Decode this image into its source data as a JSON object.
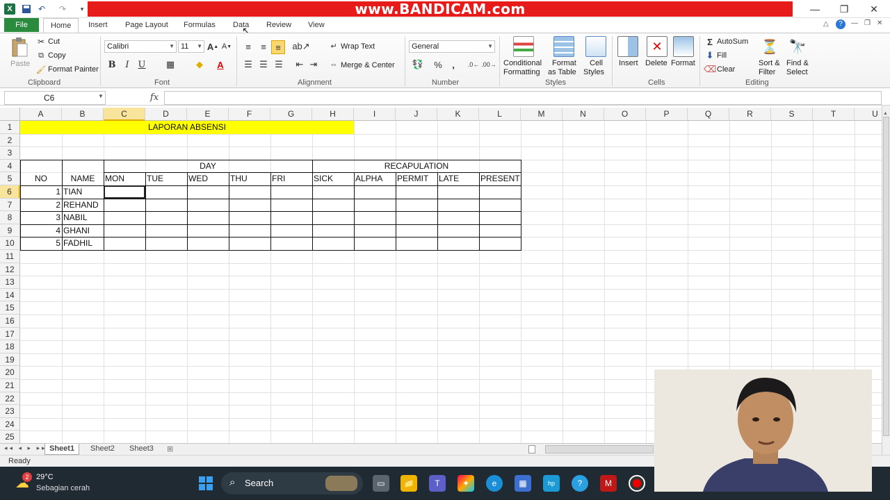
{
  "window": {
    "watermark": "www.BANDICAM.com",
    "minimize": "—",
    "restore": "❐",
    "close": "✕"
  },
  "tabs": {
    "file": "File",
    "items": [
      "Home",
      "Insert",
      "Page Layout",
      "Formulas",
      "Data",
      "Review",
      "View"
    ]
  },
  "ribbon": {
    "clipboard": {
      "paste": "Paste",
      "cut": "Cut",
      "copy": "Copy",
      "format_painter": "Format Painter",
      "label": "Clipboard"
    },
    "font": {
      "name": "Calibri",
      "size": "11",
      "bold": "B",
      "italic": "I",
      "underline": "U",
      "label": "Font"
    },
    "alignment": {
      "wrap_text": "Wrap Text",
      "merge_center": "Merge & Center",
      "label": "Alignment"
    },
    "number": {
      "format": "General",
      "percent": "%",
      "comma": ",",
      "label": "Number"
    },
    "styles": {
      "conditional": "Conditional",
      "conditional2": "Formatting",
      "format_as": "Format",
      "format_as2": "as Table",
      "cell": "Cell",
      "cell2": "Styles",
      "label": "Styles"
    },
    "cells": {
      "insert": "Insert",
      "delete": "Delete",
      "format": "Format",
      "label": "Cells"
    },
    "editing": {
      "autosum": "AutoSum",
      "fill": "Fill",
      "clear": "Clear",
      "sort": "Sort &",
      "sort2": "Filter",
      "find": "Find &",
      "find2": "Select",
      "label": "Editing"
    }
  },
  "formula_bar": {
    "name_box": "C6",
    "fx": "fx",
    "content": ""
  },
  "grid": {
    "columns": [
      "A",
      "B",
      "C",
      "D",
      "E",
      "F",
      "G",
      "H",
      "I",
      "J",
      "K",
      "L",
      "M",
      "N",
      "O",
      "P",
      "Q",
      "R",
      "S",
      "T",
      "U"
    ],
    "rows": [
      "1",
      "2",
      "3",
      "4",
      "5",
      "6",
      "7",
      "8",
      "9",
      "10",
      "11",
      "12",
      "13",
      "14",
      "15",
      "16",
      "17",
      "18",
      "19",
      "20",
      "21",
      "22",
      "23",
      "24",
      "25"
    ],
    "title": "LAPORAN ABSENSI",
    "day_header": "DAY",
    "recap_header": "RECAPULATION",
    "no_header": "NO",
    "name_header": "NAME",
    "sub_headers": [
      "MON",
      "TUE",
      "WED",
      "THU",
      "FRI",
      "SICK",
      "ALPHA",
      "PERMIT",
      "LATE",
      "PRESENT"
    ],
    "students": [
      {
        "no": "1",
        "name": "TIAN"
      },
      {
        "no": "2",
        "name": "REHAND"
      },
      {
        "no": "3",
        "name": "NABIL"
      },
      {
        "no": "4",
        "name": "GHANI"
      },
      {
        "no": "5",
        "name": "FADHIL"
      }
    ],
    "highlight_color": "#ffff00"
  },
  "sheets": [
    "Sheet1",
    "Sheet2",
    "Sheet3"
  ],
  "status": {
    "ready": "Ready"
  },
  "taskbar": {
    "weather_temp": "29°C",
    "weather_desc": "Sebagian cerah",
    "weather_badge": "2",
    "search": "Search"
  }
}
